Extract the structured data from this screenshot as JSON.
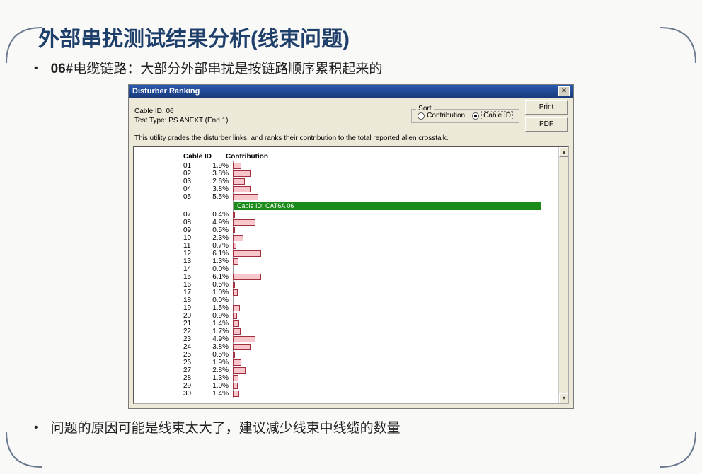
{
  "page": {
    "title": "外部串扰测试结果分析(线束问题)",
    "bullet1_prefix": "06#",
    "bullet1_rest": "电缆链路：大部分外部串扰是按链路顺序累积起来的",
    "bullet2": "问题的原因可能是线束太大了，建议减少线束中线缆的数量"
  },
  "window": {
    "title": "Disturber Ranking",
    "close": "✕",
    "cable_id_label": "Cable ID: 06",
    "test_type": "Test Type: PS ANEXT (End 1)",
    "sort_legend": "Sort",
    "sort_opt1": "Contribution",
    "sort_opt2": "Cable ID",
    "btn_print": "Print",
    "btn_pdf": "PDF",
    "desc": "This utility grades the disturber links, and ranks their contribution to the total reported alien crosstalk.",
    "col_id": "Cable ID",
    "col_contrib": "Contribution",
    "highlight": "Cable ID: CAT6A 06"
  },
  "chart_data": {
    "type": "bar",
    "title": "Disturber Ranking",
    "xlabel": "Contribution",
    "ylabel": "Cable ID",
    "highlight_id": "06",
    "highlight_label": "Cable ID: CAT6A 06",
    "series": [
      {
        "id": "01",
        "value": 1.9
      },
      {
        "id": "02",
        "value": 3.8
      },
      {
        "id": "03",
        "value": 2.6
      },
      {
        "id": "04",
        "value": 3.8
      },
      {
        "id": "05",
        "value": 5.5
      },
      {
        "id": "07",
        "value": 0.4
      },
      {
        "id": "08",
        "value": 4.9
      },
      {
        "id": "09",
        "value": 0.5
      },
      {
        "id": "10",
        "value": 2.3
      },
      {
        "id": "11",
        "value": 0.7
      },
      {
        "id": "12",
        "value": 6.1
      },
      {
        "id": "13",
        "value": 1.3
      },
      {
        "id": "14",
        "value": 0.0
      },
      {
        "id": "15",
        "value": 6.1
      },
      {
        "id": "16",
        "value": 0.5
      },
      {
        "id": "17",
        "value": 1.0
      },
      {
        "id": "18",
        "value": 0.0
      },
      {
        "id": "19",
        "value": 1.5
      },
      {
        "id": "20",
        "value": 0.9
      },
      {
        "id": "21",
        "value": 1.4
      },
      {
        "id": "22",
        "value": 1.7
      },
      {
        "id": "23",
        "value": 4.9
      },
      {
        "id": "24",
        "value": 3.8
      },
      {
        "id": "25",
        "value": 0.5
      },
      {
        "id": "26",
        "value": 1.9
      },
      {
        "id": "27",
        "value": 2.8
      },
      {
        "id": "28",
        "value": 1.3
      },
      {
        "id": "29",
        "value": 1.0
      },
      {
        "id": "30",
        "value": 1.4
      }
    ],
    "xlim": [
      0,
      100
    ]
  }
}
